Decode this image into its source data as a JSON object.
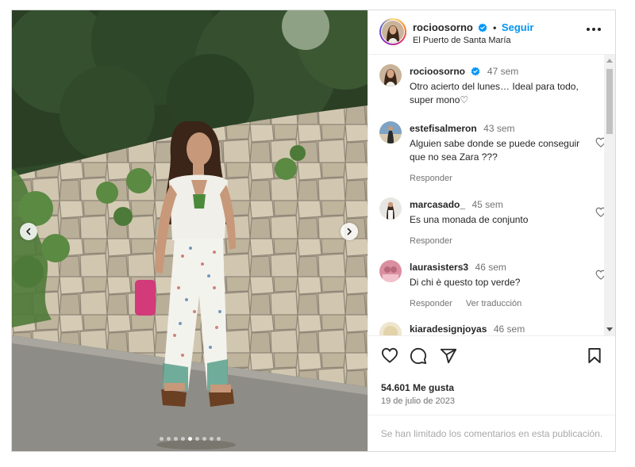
{
  "header": {
    "username": "rocioosorno",
    "separator": "•",
    "follow_label": "Seguir",
    "location": "El Puerto de Santa María",
    "more_icon": "more-horizontal-icon"
  },
  "photo": {
    "carousel_dots": 9,
    "active_dot": 4
  },
  "comments": [
    {
      "username": "rocioosorno",
      "time": "47 sem",
      "text": "Otro acierto del lunes… Ideal para todo, super mono♡",
      "verified": true,
      "actions": []
    },
    {
      "username": "estefisalmeron",
      "time": "43 sem",
      "text": "Alguien sabe donde se puede conseguir que no sea Zara ???",
      "actions": [
        "Responder"
      ]
    },
    {
      "username": "marcasado_",
      "time": "45 sem",
      "text": "Es una monada de conjunto",
      "actions": [
        "Responder"
      ]
    },
    {
      "username": "laurasisters3",
      "time": "46 sem",
      "text": "Di chi è questo top verde?",
      "actions": [
        "Responder",
        "Ver traducción"
      ]
    },
    {
      "username": "kiaradesignjoyas",
      "time": "46 sem",
      "text": "",
      "actions": []
    }
  ],
  "actions": {
    "likes": "54.601 Me gusta",
    "date": "19 de julio de 2023"
  },
  "footer": {
    "limited_text": "Se han limitado los comentarios en esta publicación."
  },
  "colors": {
    "accent": "#0095f6",
    "text": "#262626",
    "muted": "#737373"
  }
}
